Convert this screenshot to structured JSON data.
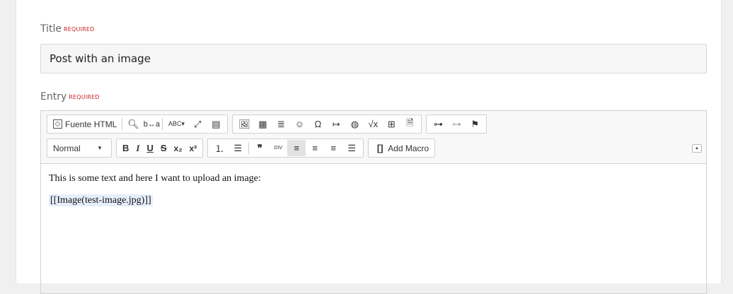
{
  "title_field": {
    "label": "Title",
    "required": "REQUIRED",
    "value": "Post with an image"
  },
  "entry_field": {
    "label": "Entry",
    "required": "REQUIRED"
  },
  "toolbar": {
    "source_label": "Fuente HTML",
    "format_value": "Normal",
    "omega": "Ω",
    "bold": "B",
    "italic": "I",
    "underline": "U",
    "strike": "S",
    "subscript": "x₂",
    "superscript": "x²",
    "add_macro_label": "Add Macro"
  },
  "content": {
    "line1": "This is some text and here I want to upload an image:",
    "line2": "[[Image(test-image.jpg)]]"
  },
  "colors": {
    "required": "#cc2222",
    "toolbar_bg": "#f8f8f8",
    "highlight": "#e6eefb"
  }
}
